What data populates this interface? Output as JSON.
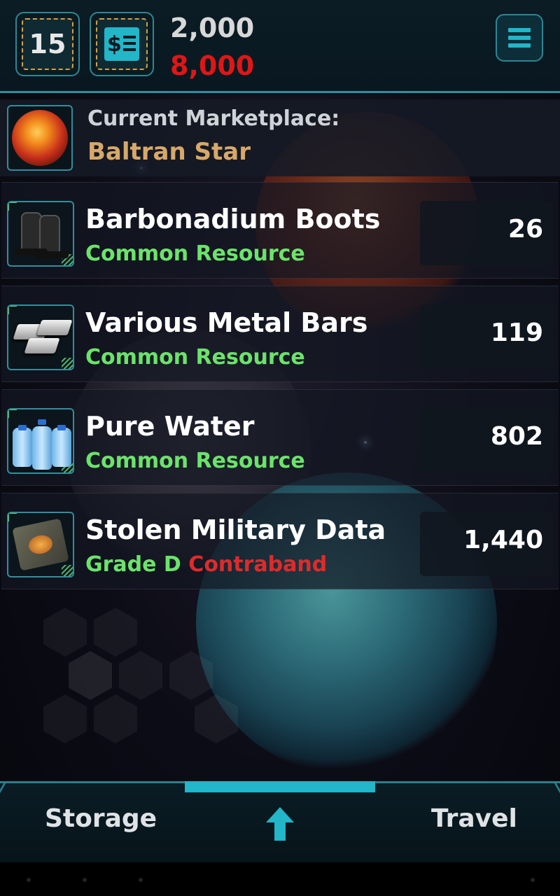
{
  "header": {
    "level": "15",
    "credits_primary": "2,000",
    "credits_secondary": "8,000",
    "credits_icon": "money-receipt-icon",
    "menu_icon": "hamburger-menu-icon",
    "credits_secondary_color": "#e01616"
  },
  "marketplace": {
    "label": "Current Marketplace:",
    "name": "Baltran Star",
    "icon": "star-planet-icon",
    "name_color": "#d7a86a"
  },
  "items": [
    {
      "name": "Barbonadium Boots",
      "grade": "Common Resource",
      "contraband": "",
      "value": "26",
      "icon": "boots-icon"
    },
    {
      "name": "Various Metal Bars",
      "grade": "Common Resource",
      "contraband": "",
      "value": "119",
      "icon": "metal-bars-icon"
    },
    {
      "name": "Pure Water",
      "grade": "Common Resource",
      "contraband": "",
      "value": "802",
      "icon": "water-jugs-icon"
    },
    {
      "name": "Stolen Military Data",
      "grade": "Grade D",
      "contraband": "Contraband",
      "value": "1,440",
      "icon": "data-pad-icon"
    }
  ],
  "colors": {
    "accent": "#23b5c8",
    "resource_green": "#6be36b",
    "contraband_red": "#e02a2a"
  },
  "bottom_nav": {
    "storage_label": "Storage",
    "travel_label": "Travel",
    "center_icon": "up-arrow-icon"
  }
}
